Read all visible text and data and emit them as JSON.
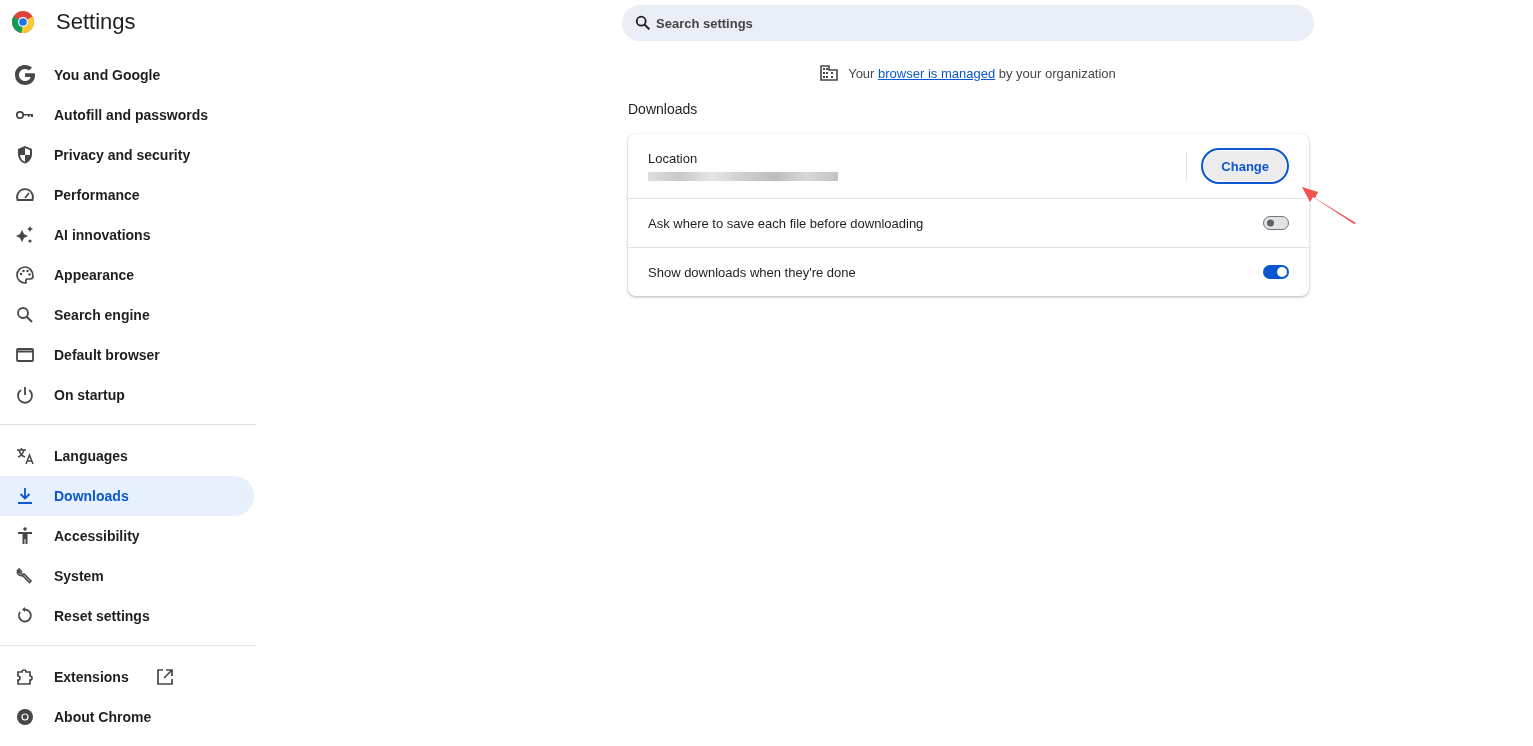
{
  "header": {
    "title": "Settings"
  },
  "sidebar": {
    "groups": [
      {
        "items": [
          {
            "label": "You and Google",
            "selected": false
          },
          {
            "label": "Autofill and passwords",
            "selected": false
          },
          {
            "label": "Privacy and security",
            "selected": false
          },
          {
            "label": "Performance",
            "selected": false
          },
          {
            "label": "AI innovations",
            "selected": false
          },
          {
            "label": "Appearance",
            "selected": false
          },
          {
            "label": "Search engine",
            "selected": false
          },
          {
            "label": "Default browser",
            "selected": false
          },
          {
            "label": "On startup",
            "selected": false
          }
        ]
      },
      {
        "items": [
          {
            "label": "Languages",
            "selected": false
          },
          {
            "label": "Downloads",
            "selected": true
          },
          {
            "label": "Accessibility",
            "selected": false
          },
          {
            "label": "System",
            "selected": false
          },
          {
            "label": "Reset settings",
            "selected": false
          }
        ]
      },
      {
        "items": [
          {
            "label": "Extensions",
            "selected": false,
            "external": true
          },
          {
            "label": "About Chrome",
            "selected": false
          }
        ]
      }
    ]
  },
  "search": {
    "placeholder": "Search settings"
  },
  "managed_notice": {
    "before": "Your",
    "link": "browser is managed",
    "after": "by your organization"
  },
  "section": {
    "title": "Downloads",
    "location": {
      "label": "Location",
      "button": "Change"
    },
    "toggles": [
      {
        "label": "Ask where to save each file before downloading",
        "on": false
      },
      {
        "label": "Show downloads when they're done",
        "on": true
      }
    ]
  }
}
